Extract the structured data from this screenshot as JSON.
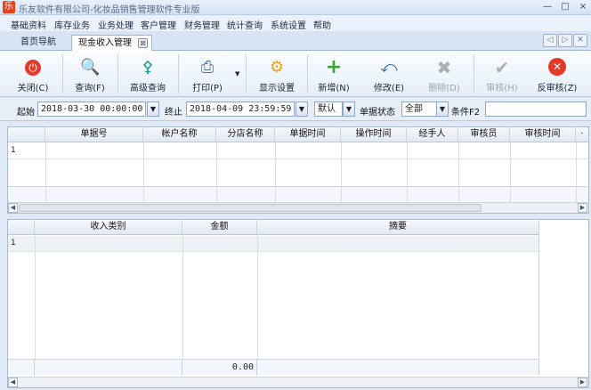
{
  "window": {
    "title": "乐友软件有限公司-化妆品销售管理软件专业版",
    "logo_text": "乐",
    "minimize": "—",
    "maximize": "□",
    "close": "×"
  },
  "menu": [
    "基础资料",
    "库存业务",
    "业务处理",
    "客户管理",
    "财务管理",
    "统计查询",
    "系统设置",
    "帮助"
  ],
  "tabs": {
    "home": "首页导航",
    "active": "现金收入管理",
    "close": "⊠"
  },
  "toolbar": {
    "close": "关闭(C)",
    "query": "查询(F)",
    "advanced_query": "高级查询",
    "print": "打印(P)",
    "display_settings": "显示设置",
    "new": "新增(N)",
    "modify": "修改(E)",
    "delete": "删除(D)",
    "audit": "审核(H)",
    "unaudit": "反审核(Z)"
  },
  "filter": {
    "start_label": "起始",
    "start_value": "2018-03-30 00:00:00",
    "end_label": "终止",
    "end_value": "2018-04-09 23:59:59",
    "default_value": "默认",
    "status_label": "单据状态",
    "status_value": "全部",
    "condition_label": "条件F2",
    "condition_value": ""
  },
  "top_grid": {
    "columns": [
      "单据号",
      "帐户名称",
      "分店名称",
      "单据时间",
      "操作时间",
      "经手人",
      "审核员",
      "审核时间"
    ],
    "rows": [
      {
        "num": "1"
      }
    ]
  },
  "bottom_grid": {
    "columns": [
      "收入类别",
      "金额",
      "摘要"
    ],
    "rows": [
      {
        "num": "1"
      }
    ],
    "total_amount": "0.00"
  }
}
